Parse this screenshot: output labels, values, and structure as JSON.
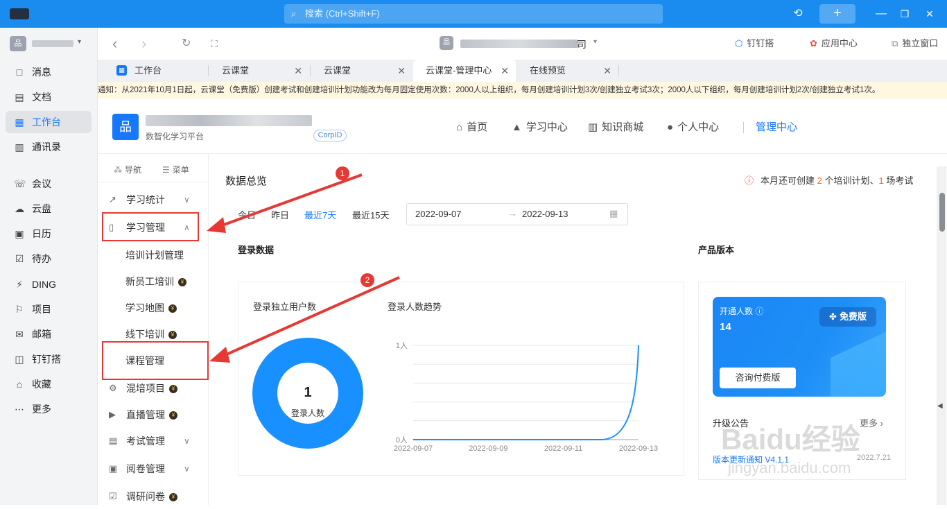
{
  "top_bar": {
    "search_placeholder": "搜索 (Ctrl+Shift+F)",
    "search_icon": "search-icon",
    "history_icon": "history-icon",
    "add_label": "+",
    "min_label": "—",
    "restore_label": "❐",
    "close_label": "✕"
  },
  "sidebar": {
    "org_avatar": "品",
    "org_dropdown": "▾",
    "items": [
      {
        "label": "消息",
        "icon": "□"
      },
      {
        "label": "文档",
        "icon": "▤"
      },
      {
        "label": "工作台",
        "icon": "▦"
      },
      {
        "label": "通讯录",
        "icon": "▥"
      },
      {
        "label": "会议",
        "icon": "☏"
      },
      {
        "label": "云盘",
        "icon": "☁"
      },
      {
        "label": "日历",
        "icon": "▣"
      },
      {
        "label": "待办",
        "icon": "☑"
      },
      {
        "label": "DING",
        "icon": "⚡"
      },
      {
        "label": "项目",
        "icon": "⚐"
      },
      {
        "label": "邮箱",
        "icon": "✉"
      },
      {
        "label": "钉钉搭",
        "icon": "◫"
      },
      {
        "label": "收藏",
        "icon": "⌂"
      },
      {
        "label": "更多",
        "icon": "⋯"
      }
    ]
  },
  "toolbar": {
    "back": "‹",
    "forward": "›",
    "refresh": "↻",
    "fullscreen": "⛶",
    "addr_suffix": "司",
    "addr_dropdown": "▾",
    "links": [
      {
        "label": "钉钉搭",
        "icon": "⬡"
      },
      {
        "label": "应用中心",
        "icon": "✿"
      },
      {
        "label": "独立窗口",
        "icon": "⧉"
      }
    ]
  },
  "tabs": [
    {
      "label": "工作台",
      "close": ""
    },
    {
      "label": "云课堂",
      "close": "✕"
    },
    {
      "label": "云课堂",
      "close": "✕"
    },
    {
      "label": "云课堂-管理中心",
      "close": "✕"
    },
    {
      "label": "在线预览",
      "close": "✕"
    }
  ],
  "notice": "通知：从2021年10月1日起，云课堂（免费版）创建考试和创建培训计划功能改为每月固定使用次数：2000人以上组织，每月创建培训计划3次/创建独立考试3次；2000人以下组织，每月创建培训计划2次/创建独立考试1次。",
  "header": {
    "logo_icon": "品",
    "subtitle": "数智化学习平台",
    "corpid": "CorpID",
    "menu": [
      {
        "label": "首页",
        "icon": "⌂"
      },
      {
        "label": "学习中心",
        "icon": "▲"
      },
      {
        "label": "知识商城",
        "icon": "▥"
      },
      {
        "label": "个人中心",
        "icon": "●"
      }
    ],
    "admin": "管理中心"
  },
  "side_menu": {
    "nav_label": "导航",
    "menu_label": "菜单",
    "items": [
      {
        "label": "学习统计",
        "icon": "↗",
        "chevron": "∨",
        "coin": ""
      },
      {
        "label": "学习管理",
        "icon": "▯",
        "chevron": "∧",
        "coin": ""
      },
      {
        "label": "培训计划管理",
        "icon": "",
        "chevron": "",
        "coin": ""
      },
      {
        "label": "新员工培训",
        "icon": "",
        "chevron": "",
        "coin": "¥"
      },
      {
        "label": "学习地图",
        "icon": "",
        "chevron": "",
        "coin": "¥"
      },
      {
        "label": "线下培训",
        "icon": "",
        "chevron": "",
        "coin": "¥"
      },
      {
        "label": "课程管理",
        "icon": "",
        "chevron": "",
        "coin": ""
      },
      {
        "label": "混培项目",
        "icon": "⚙",
        "chevron": "",
        "coin": "¥"
      },
      {
        "label": "直播管理",
        "icon": "▶",
        "chevron": "",
        "coin": "¥"
      },
      {
        "label": "考试管理",
        "icon": "▤",
        "chevron": "∨",
        "coin": ""
      },
      {
        "label": "阅卷管理",
        "icon": "▣",
        "chevron": "∨",
        "coin": ""
      },
      {
        "label": "调研问卷",
        "icon": "☑",
        "chevron": "",
        "coin": "¥"
      }
    ]
  },
  "main": {
    "title": "数据总览",
    "quota": {
      "warn_icon": "ⓘ",
      "p1": "本月还可创建 ",
      "n1": "2",
      "p2": " 个培训计划、",
      "n2": "1",
      "p3": " 场考试"
    },
    "ranges": [
      "今日",
      "昨日",
      "最近7天",
      "最近15天"
    ],
    "active_range": "最近7天",
    "date_start": "2022-09-07",
    "date_arrow": "→",
    "date_end": "2022-09-13",
    "calendar_icon": "▦",
    "login_section": "登录数据",
    "product_section": "产品版本",
    "unique_users_title": "登录独立用户数",
    "trend_title": "登录人数趋势",
    "donut_value": "1",
    "donut_label": "登录人数",
    "product": {
      "open_label": "开通人数 ⓘ",
      "open_value": "14",
      "edition": "免费版",
      "consult": "咨询付费版",
      "upgrade": "升级公告",
      "more": "更多 ›",
      "version_note": "版本更新通知 V4.1.1",
      "version_date": "2022.7.21"
    }
  },
  "chart_data": {
    "type": "line",
    "title": "登录人数趋势",
    "x_ticks": [
      "2022-09-07",
      "2022-09-09",
      "2022-09-11",
      "2022-09-13"
    ],
    "y_ticks": [
      "0人",
      "1人"
    ],
    "ylim": [
      0,
      1
    ],
    "x": [
      "2022-09-07",
      "2022-09-08",
      "2022-09-09",
      "2022-09-10",
      "2022-09-11",
      "2022-09-12",
      "2022-09-13"
    ],
    "series": [
      {
        "values": [
          0,
          0,
          0,
          0,
          0,
          0,
          1
        ],
        "color": "#1890ff"
      }
    ],
    "grid": true
  },
  "annotations": {
    "badge1": "1",
    "badge2": "2"
  },
  "watermark": {
    "main": "Baidu经验",
    "sub": "jingyan.baidu.com"
  }
}
